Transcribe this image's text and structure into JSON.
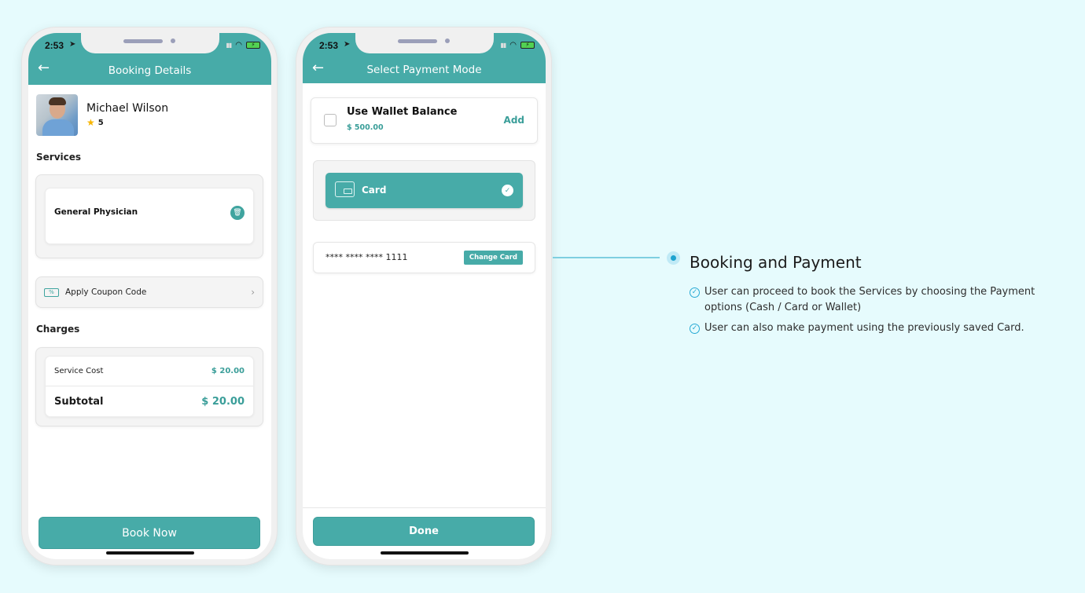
{
  "status_bar": {
    "time": "2:53"
  },
  "screen1": {
    "title": "Booking Details",
    "doctor": {
      "name": "Michael Wilson",
      "rating": "5"
    },
    "services_label": "Services",
    "services": [
      {
        "name": "General Physician"
      }
    ],
    "coupon_label": "Apply Coupon Code",
    "charges_label": "Charges",
    "charges": {
      "service_cost_label": "Service Cost",
      "service_cost": "$ 20.00",
      "subtotal_label": "Subtotal",
      "subtotal": "$ 20.00"
    },
    "book_button": "Book Now"
  },
  "screen2": {
    "title": "Select Payment Mode",
    "wallet": {
      "label": "Use Wallet Balance",
      "balance": "$ 500.00",
      "add_label": "Add",
      "checked": false
    },
    "card_option": {
      "label": "Card",
      "selected": true
    },
    "saved_card": {
      "number": "**** **** **** 1111",
      "change_label": "Change Card"
    },
    "done_button": "Done"
  },
  "feature": {
    "title": "Booking and Payment",
    "items": [
      "User can proceed to book the Services by choosing the Payment options (Cash / Card or Wallet)",
      "User can also make payment using the previously saved Card."
    ]
  },
  "colors": {
    "primary": "#47aba8",
    "background": "#e6fbfd",
    "accent_blue": "#1ea3cf"
  }
}
